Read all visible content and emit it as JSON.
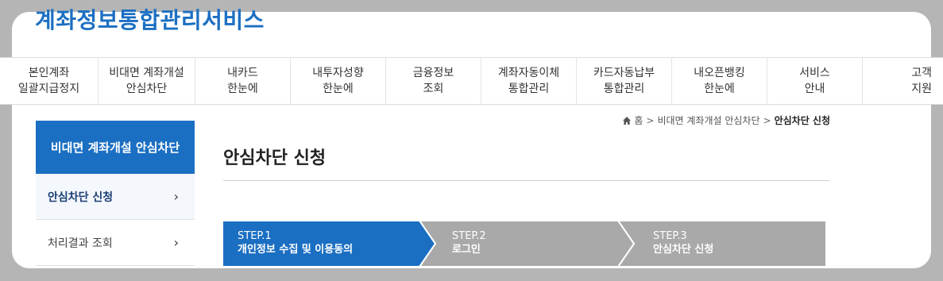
{
  "site": {
    "title": "계좌정보통합관리서비스"
  },
  "gnb": {
    "items": [
      {
        "line1": "본인계좌",
        "line2": "일괄지급정지"
      },
      {
        "line1": "비대면 계좌개설",
        "line2": "안심차단"
      },
      {
        "line1": "내카드",
        "line2": "한눈에"
      },
      {
        "line1": "내투자성향",
        "line2": "한눈에"
      },
      {
        "line1": "금융정보",
        "line2": "조회"
      },
      {
        "line1": "계좌자동이체",
        "line2": "통합관리"
      },
      {
        "line1": "카드자동납부",
        "line2": "통합관리"
      },
      {
        "line1": "내오픈뱅킹",
        "line2": "한눈에"
      },
      {
        "line1": "서비스",
        "line2": "안내"
      },
      {
        "line1": "고객",
        "line2": "지원"
      }
    ]
  },
  "lnb": {
    "title": "비대면 계좌개설 안심차단",
    "items": [
      {
        "label": "안심차단 신청",
        "arrow": "›"
      },
      {
        "label": "처리결과 조회",
        "arrow": "›"
      }
    ]
  },
  "breadcrumb": {
    "home": "홈",
    "separator": ">",
    "level1": "비대면 계좌개설 안심차단",
    "current": "안심차단 신청"
  },
  "page": {
    "title": "안심차단 신청"
  },
  "steps": [
    {
      "num": "STEP.1",
      "label": "개인정보 수집 및 이용동의",
      "active": true
    },
    {
      "num": "STEP.2",
      "label": "로그인",
      "active": false
    },
    {
      "num": "STEP.3",
      "label": "안심차단 신청",
      "active": false
    }
  ],
  "colors": {
    "brand": "#1b6fc2",
    "step_active": "#1b6fc2",
    "step_inactive": "#a9a9a9",
    "backdrop": "#b5b5b5"
  }
}
